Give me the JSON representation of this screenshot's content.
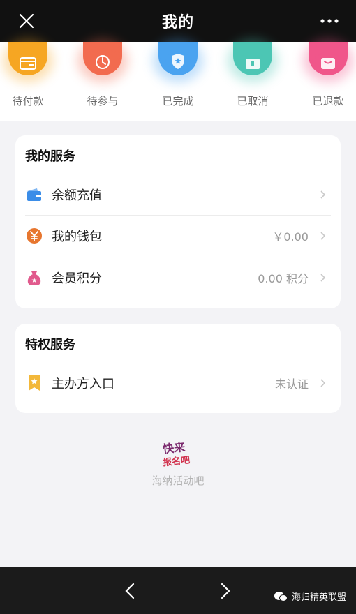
{
  "header": {
    "title": "我的"
  },
  "orders": [
    {
      "label": "待付款",
      "color": "#f6a623",
      "icon": "wallet-card-icon"
    },
    {
      "label": "待参与",
      "color": "#f26b4f",
      "icon": "clock-icon"
    },
    {
      "label": "已完成",
      "color": "#4aa3f0",
      "icon": "shield-star-icon"
    },
    {
      "label": "已取消",
      "color": "#4cc6b4",
      "icon": "box-icon"
    },
    {
      "label": "已退款",
      "color": "#f0568a",
      "icon": "refund-box-icon"
    }
  ],
  "my_services": {
    "title": "我的服务",
    "items": [
      {
        "label": "余额充值",
        "value": "",
        "icon": "wallet-icon",
        "color": "#3b8de8"
      },
      {
        "label": "我的钱包",
        "value": "￥0.00",
        "icon": "yen-coin-icon",
        "color": "#e7762f"
      },
      {
        "label": "会员积分",
        "value": "0.00 积分",
        "icon": "money-bag-icon",
        "color": "#e15a8d"
      }
    ]
  },
  "privilege": {
    "title": "特权服务",
    "items": [
      {
        "label": "主办方入口",
        "value": "未认证",
        "icon": "bookmark-star-icon",
        "color": "#f3b83a"
      }
    ]
  },
  "footer": {
    "logo_line1": "快来",
    "logo_line2": "报名吧",
    "text": "海纳活动吧"
  },
  "watermark": {
    "text": "海归精英联盟"
  }
}
